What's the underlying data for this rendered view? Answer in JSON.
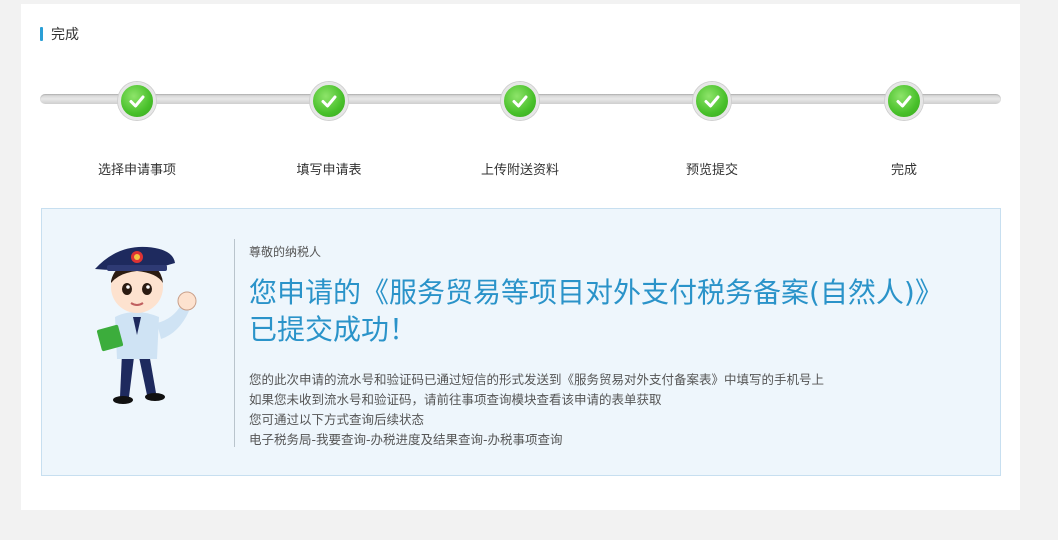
{
  "section": {
    "title": "完成"
  },
  "steps": [
    {
      "label": "选择申请事项",
      "completed": true
    },
    {
      "label": "填写申请表",
      "completed": true
    },
    {
      "label": "上传附送资料",
      "completed": true
    },
    {
      "label": "预览提交",
      "completed": true
    },
    {
      "label": "完成",
      "completed": true
    }
  ],
  "notice": {
    "greeting": "尊敬的纳税人",
    "headline": "您申请的《服务贸易等项目对外支付税务备案(自然人)》已提交成功！",
    "lines": [
      "您的此次申请的流水号和验证码已通过短信的形式发送到《服务贸易对外支付备案表》中填写的手机号上",
      "如果您未收到流水号和验证码，请前往事项查询模块查看该申请的表单获取",
      "您可通过以下方式查询后续状态",
      "电子税务局-我要查询-办税进度及结果查询-办税事项查询"
    ],
    "mascot_icon": "tax-officer-mascot"
  },
  "colors": {
    "accent": "#2a9fd6",
    "headline": "#2a93c9",
    "success": "#48c02a",
    "notice_bg": "#eef6fc"
  }
}
